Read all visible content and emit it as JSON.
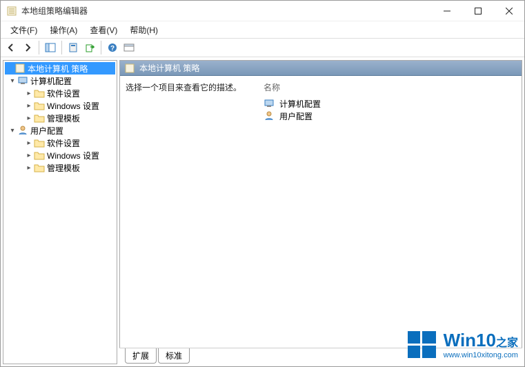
{
  "window": {
    "title": "本地组策略编辑器"
  },
  "menu": {
    "file": "文件(F)",
    "action": "操作(A)",
    "view": "查看(V)",
    "help": "帮助(H)"
  },
  "tree": {
    "root": "本地计算机 策略",
    "computer": "计算机配置",
    "user": "用户配置",
    "soft": "软件设置",
    "win": "Windows 设置",
    "admin": "管理模板"
  },
  "right": {
    "title": "本地计算机 策略",
    "desc": "选择一个项目来查看它的描述。",
    "col_name": "名称",
    "items": {
      "computer": "计算机配置",
      "user": "用户配置"
    }
  },
  "tabs": {
    "ext": "扩展",
    "std": "标准"
  },
  "watermark": {
    "brand": "Win10",
    "suffix": "之家",
    "url": "www.win10xitong.com"
  }
}
